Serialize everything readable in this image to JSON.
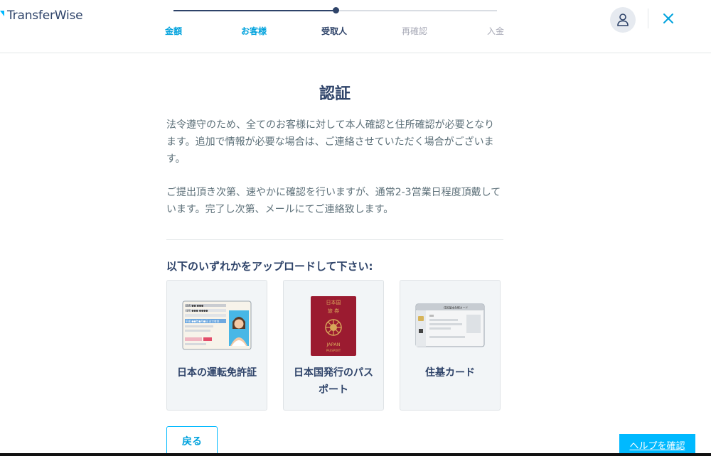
{
  "header": {
    "logo_text": "TransferWise",
    "steps": [
      {
        "label": "金額",
        "state": "done"
      },
      {
        "label": "お客様",
        "state": "done"
      },
      {
        "label": "受取人",
        "state": "active"
      },
      {
        "label": "再確認",
        "state": "todo"
      },
      {
        "label": "入金",
        "state": "todo"
      }
    ],
    "progress_fraction": 0.5,
    "profile_icon": "user-icon",
    "close_icon": "close-icon"
  },
  "main": {
    "title": "認証",
    "paragraph1": "法令遵守のため、全てのお客様に対して本人確認と住所確認が必要となります。追加で情報が必要な場合は、ご連絡させていただく場合がございます。",
    "paragraph2": "ご提出頂き次第、速やかに確認を行いますが、通常2-3営業日程度頂戴しています。完了し次第、メールにてご連絡致します。",
    "upload_heading": "以下のいずれかをアップロードして下さい:",
    "options": [
      {
        "label": "日本の運転免許証",
        "icon": "drivers-license-icon"
      },
      {
        "label": "日本国発行のパスポート",
        "icon": "passport-icon"
      },
      {
        "label": "住基カード",
        "icon": "juki-card-icon"
      }
    ],
    "back_label": "戻る"
  },
  "help": {
    "label": "ヘルプを確認"
  },
  "images": {
    "license_lines": [
      "氏名 ●● ●●●",
      "住所 ●●● ●●●●",
      "平成 ●●年●月●日 まで有効"
    ],
    "passport_top": "日本国",
    "passport_mid": "旅 券",
    "passport_bottom": "JAPAN",
    "passport_sub": "PASSPORT",
    "juki_title": "住民基本台帳カード"
  },
  "colors": {
    "accent": "#00b9ff",
    "navy": "#2e4369",
    "passport_red": "#9b1b30"
  }
}
